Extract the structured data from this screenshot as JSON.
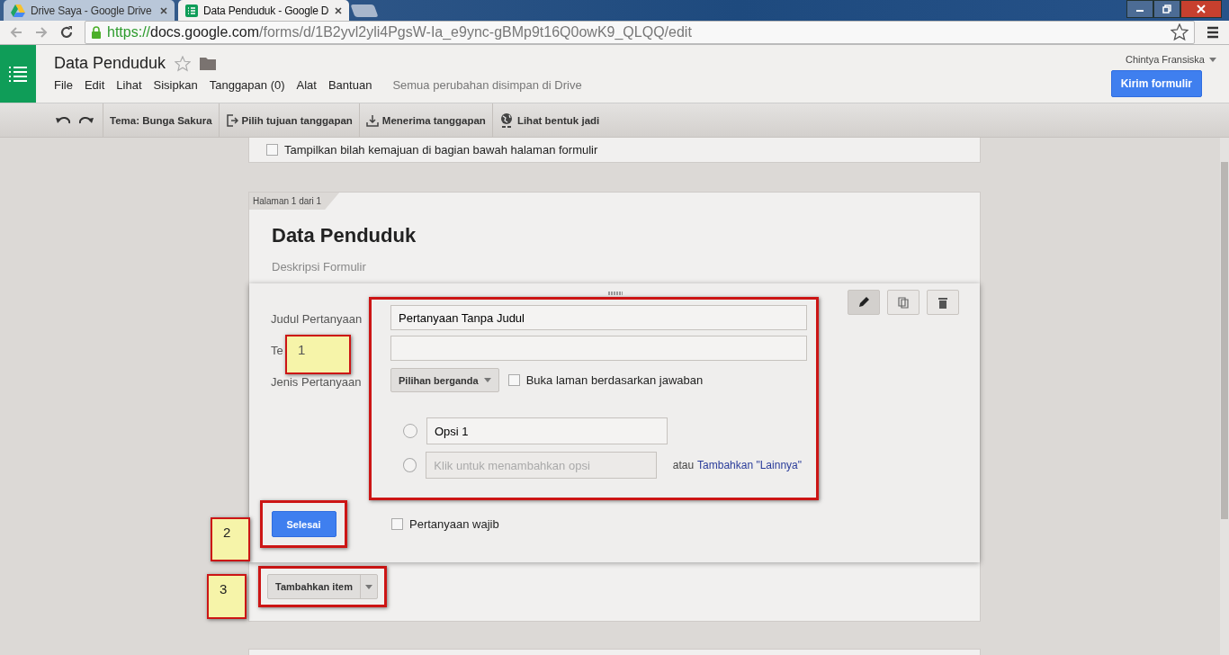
{
  "browser": {
    "tabs": [
      {
        "title": "Drive Saya - Google Drive",
        "selected": false
      },
      {
        "title": "Data Penduduk - Google D",
        "selected": true
      }
    ],
    "url": {
      "scheme": "https://",
      "host": "docs.google.com",
      "path": "/forms/d/1B2yvl2yli4PgsW-Ia_e9ync-gBMp9t16Q0owK9_QLQQ/edit"
    }
  },
  "app": {
    "title": "Data Penduduk",
    "menu": [
      "File",
      "Edit",
      "Lihat",
      "Sisipkan",
      "Tanggapan (0)",
      "Alat",
      "Bantuan"
    ],
    "save_status": "Semua perubahan disimpan di Drive",
    "user": "Chintya Fransiska",
    "send_button": "Kirim formulir"
  },
  "toolbar": {
    "theme": "Tema: Bunga Sakura",
    "buttons": [
      "Pilih tujuan tanggapan",
      "Menerima tanggapan",
      "Lihat bentuk jadi"
    ]
  },
  "settings": {
    "progress_checkbox": {
      "label": "Tampilkan bilah kemajuan di bagian bawah halaman formulir",
      "checked": false
    }
  },
  "page": {
    "badge": "Halaman 1 dari 1",
    "form_title": "Data Penduduk",
    "form_description": {
      "placeholder": "Deskripsi Formulir"
    }
  },
  "question": {
    "labels": [
      "Judul Pertanyaan",
      "Te",
      "Jenis Pertanyaan"
    ],
    "title_value": "Pertanyaan Tanpa Judul",
    "type_select": "Pilihan berganda",
    "branch_checkbox": {
      "label": "Buka laman berdasarkan jawaban",
      "checked": false
    },
    "options": [
      {
        "value": "Opsi 1",
        "selected": false
      }
    ],
    "add_option": {
      "placeholder": "Klik untuk menambahkan opsi",
      "selected": false
    },
    "other_prefix": "atau",
    "other_link": "Tambahkan \"Lainnya\"",
    "done_button": "Selesai",
    "required": {
      "label": "Pertanyaan wajib",
      "checked": false
    }
  },
  "add_item": "Tambahkan item",
  "callouts": [
    "1",
    "2",
    "3"
  ]
}
